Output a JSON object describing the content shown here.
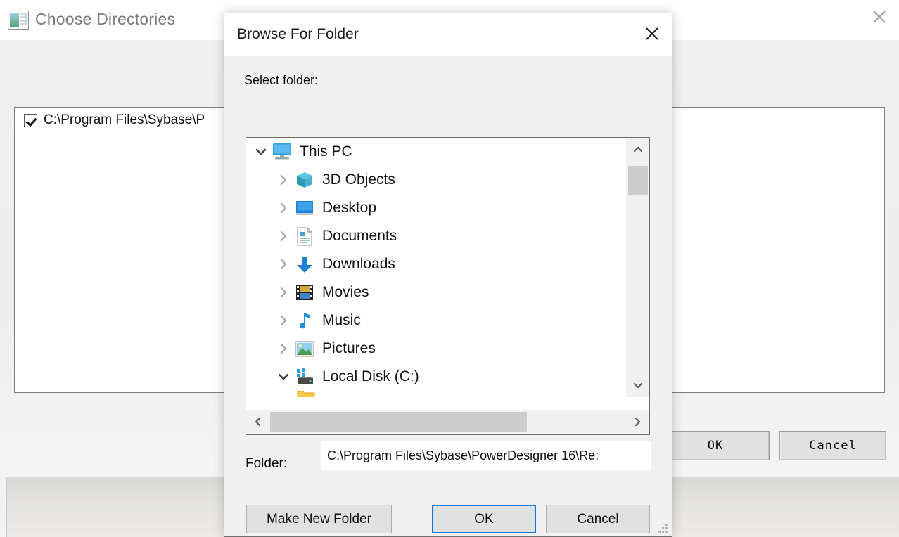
{
  "app_window": {
    "title": "Choose Directories",
    "title_icon": "window-list-icon",
    "close_icon": "close-icon",
    "toolbar": [
      {
        "name": "add-directory-button",
        "icon": "table-add-icon",
        "enabled": true
      },
      {
        "name": "remove-directory-button",
        "icon": "x-delete-icon",
        "enabled": false
      },
      {
        "name": "move-up-button",
        "icon": "arrow-up-icon",
        "enabled": true
      },
      {
        "name": "move-down-button",
        "icon": "arrow-down-icon",
        "enabled": true
      },
      {
        "name": "delete-table-button",
        "icon": "table-delete-icon",
        "enabled": true
      }
    ],
    "directory_list": {
      "rows": [
        {
          "checked": true,
          "path": "C:\\Program Files\\Sybase\\P"
        }
      ]
    },
    "buttons": {
      "ok_label": "OK",
      "cancel_label": "Cancel"
    }
  },
  "browse_dialog": {
    "title": "Browse For Folder",
    "close_icon": "close-icon",
    "select_label": "Select folder:",
    "tree": {
      "items": [
        {
          "label": "This PC",
          "icon": "monitor-icon",
          "indent": 0,
          "expander": "expanded"
        },
        {
          "label": "3D Objects",
          "icon": "cube-3d-icon",
          "indent": 1,
          "expander": "collapsed"
        },
        {
          "label": "Desktop",
          "icon": "desktop-icon",
          "indent": 1,
          "expander": "collapsed"
        },
        {
          "label": "Documents",
          "icon": "document-icon",
          "indent": 1,
          "expander": "collapsed"
        },
        {
          "label": "Downloads",
          "icon": "download-icon",
          "indent": 1,
          "expander": "collapsed"
        },
        {
          "label": "Movies",
          "icon": "film-icon",
          "indent": 1,
          "expander": "collapsed"
        },
        {
          "label": "Music",
          "icon": "music-note-icon",
          "indent": 1,
          "expander": "collapsed"
        },
        {
          "label": "Pictures",
          "icon": "picture-icon",
          "indent": 1,
          "expander": "collapsed"
        },
        {
          "label": "Local Disk (C:)",
          "icon": "hard-drive-icon",
          "indent": 1,
          "expander": "expanded"
        }
      ],
      "vertical_scrollbar": {
        "up_icon": "chevron-up-icon",
        "down_icon": "chevron-down-icon"
      },
      "horizontal_scrollbar": {
        "left_icon": "chevron-left-icon",
        "right_icon": "chevron-right-icon"
      }
    },
    "folder_field": {
      "label": "Folder:",
      "value": "C:\\Program Files\\Sybase\\PowerDesigner 16\\Re:"
    },
    "buttons": {
      "make_new_folder_label": "Make New Folder",
      "ok_label": "OK",
      "cancel_label": "Cancel"
    },
    "resize_grip_icon": "resize-grip-icon"
  },
  "colors": {
    "accent_focus": "#0078d7",
    "dialog_bg": "#f0f0f0",
    "field_bg": "#ffffff",
    "scrollbar_thumb": "#cdcdcd"
  }
}
